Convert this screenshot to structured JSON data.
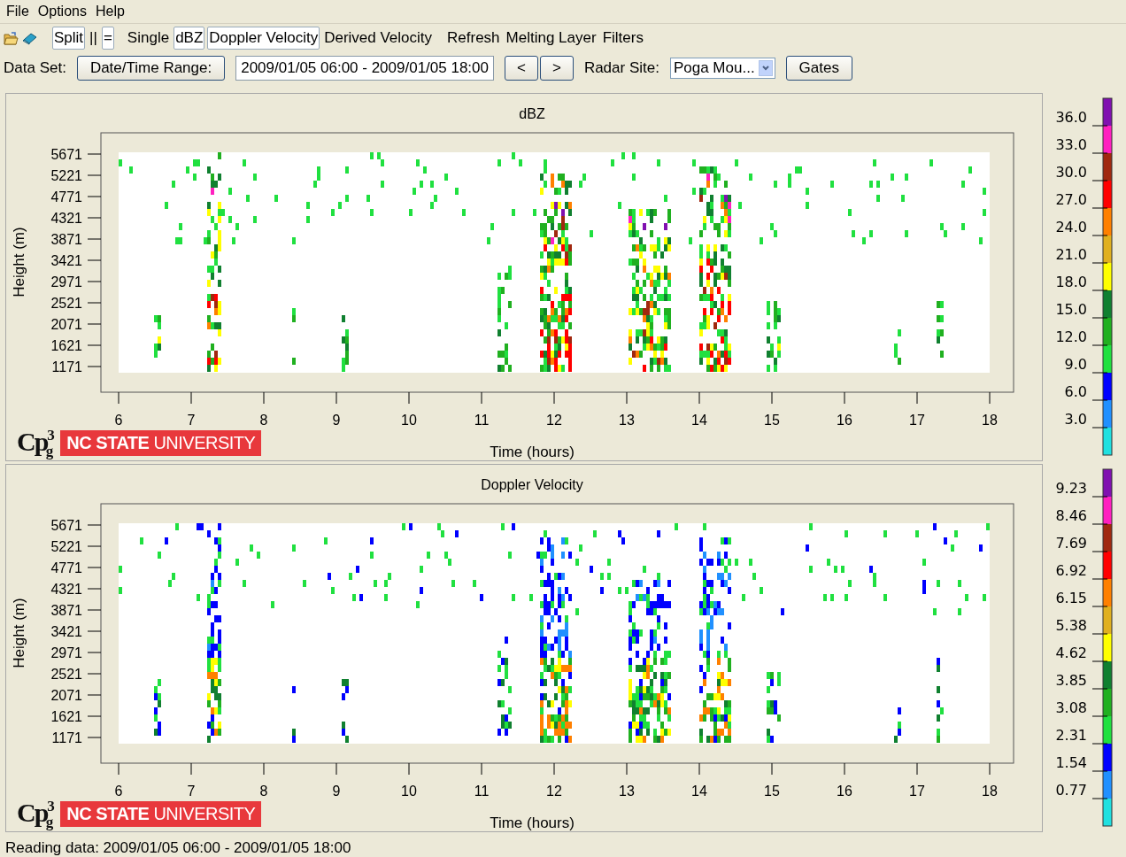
{
  "menu": [
    "File",
    "Options",
    "Help"
  ],
  "toolbar": [
    {
      "label": "Split",
      "selected": true
    },
    {
      "label": "||",
      "selected": false
    },
    {
      "label": "=",
      "selected": true
    },
    {
      "label": "Single",
      "selected": false
    },
    {
      "label": "dBZ",
      "selected": true
    },
    {
      "label": "Doppler Velocity",
      "selected": true
    },
    {
      "label": "Derived Velocity",
      "selected": false
    },
    {
      "label": "Refresh",
      "selected": false
    },
    {
      "label": "Melting Layer",
      "selected": false
    },
    {
      "label": "Filters",
      "selected": false
    }
  ],
  "dataset": {
    "label": "Data Set:",
    "range_button": "Date/Time Range:",
    "range_value": "2009/01/05 06:00 - 2009/01/05 18:00",
    "prev": "<",
    "next": ">",
    "site_label": "Radar Site:",
    "site_value": "Poga Mou...",
    "gates_button": "Gates"
  },
  "panels": [
    {
      "title": "dBZ",
      "kind": "reflectivity",
      "ylabel": "Height (m)",
      "xlabel": "Time (hours)",
      "yticks": [
        "5671",
        "5221",
        "4771",
        "4321",
        "3871",
        "3421",
        "2971",
        "2521",
        "2071",
        "1621",
        "1171"
      ],
      "xticks": [
        "6",
        "7",
        "8",
        "9",
        "10",
        "11",
        "12",
        "13",
        "14",
        "15",
        "16",
        "17",
        "18"
      ],
      "logo": {
        "mark": "Cp$^{3}$$_{g}$",
        "banner_bold": "NC STATE",
        "banner": "UNIVERSITY"
      },
      "scale": {
        "labels": [
          "36.0",
          "33.0",
          "30.0",
          "27.0",
          "24.0",
          "21.0",
          "18.0",
          "15.0",
          "12.0",
          "9.0",
          "6.0",
          "3.0"
        ],
        "segments": [
          {
            "color": "#8010b0"
          },
          {
            "color": "#ff20c0"
          },
          {
            "color": "#a02810"
          },
          {
            "color": "#ff0000"
          },
          {
            "color": "#ff8000"
          },
          {
            "color": "#e0b020"
          },
          {
            "color": "#ffff00"
          },
          {
            "color": "#108030"
          },
          {
            "color": "#20b020"
          },
          {
            "color": "#20e040"
          },
          {
            "color": "#0000ff"
          },
          {
            "color": "#2090ff"
          },
          {
            "color": "#20e0e0"
          }
        ]
      }
    },
    {
      "title": "Doppler Velocity",
      "kind": "velocity",
      "ylabel": "Height (m)",
      "xlabel": "Time (hours)",
      "yticks": [
        "5671",
        "5221",
        "4771",
        "4321",
        "3871",
        "3421",
        "2971",
        "2521",
        "2071",
        "1621",
        "1171"
      ],
      "xticks": [
        "6",
        "7",
        "8",
        "9",
        "10",
        "11",
        "12",
        "13",
        "14",
        "15",
        "16",
        "17",
        "18"
      ],
      "logo": {
        "mark": "Cp$^{3}$$_{g}$",
        "banner_bold": "NC STATE",
        "banner": "UNIVERSITY"
      },
      "scale": {
        "labels": [
          "9.23",
          "8.46",
          "7.69",
          "6.92",
          "6.15",
          "5.38",
          "4.62",
          "3.85",
          "3.08",
          "2.31",
          "1.54",
          "0.77"
        ],
        "segments": [
          {
            "color": "#8010b0"
          },
          {
            "color": "#ff20c0"
          },
          {
            "color": "#a02810"
          },
          {
            "color": "#ff0000"
          },
          {
            "color": "#ff8000"
          },
          {
            "color": "#e0b020"
          },
          {
            "color": "#ffff00"
          },
          {
            "color": "#108030"
          },
          {
            "color": "#20b020"
          },
          {
            "color": "#20e040"
          },
          {
            "color": "#0000ff"
          },
          {
            "color": "#2090ff"
          },
          {
            "color": "#20e0e0"
          }
        ]
      }
    }
  ],
  "status_bar": "Reading data: 2009/01/05 06:00 - 2009/01/05 18:00"
}
